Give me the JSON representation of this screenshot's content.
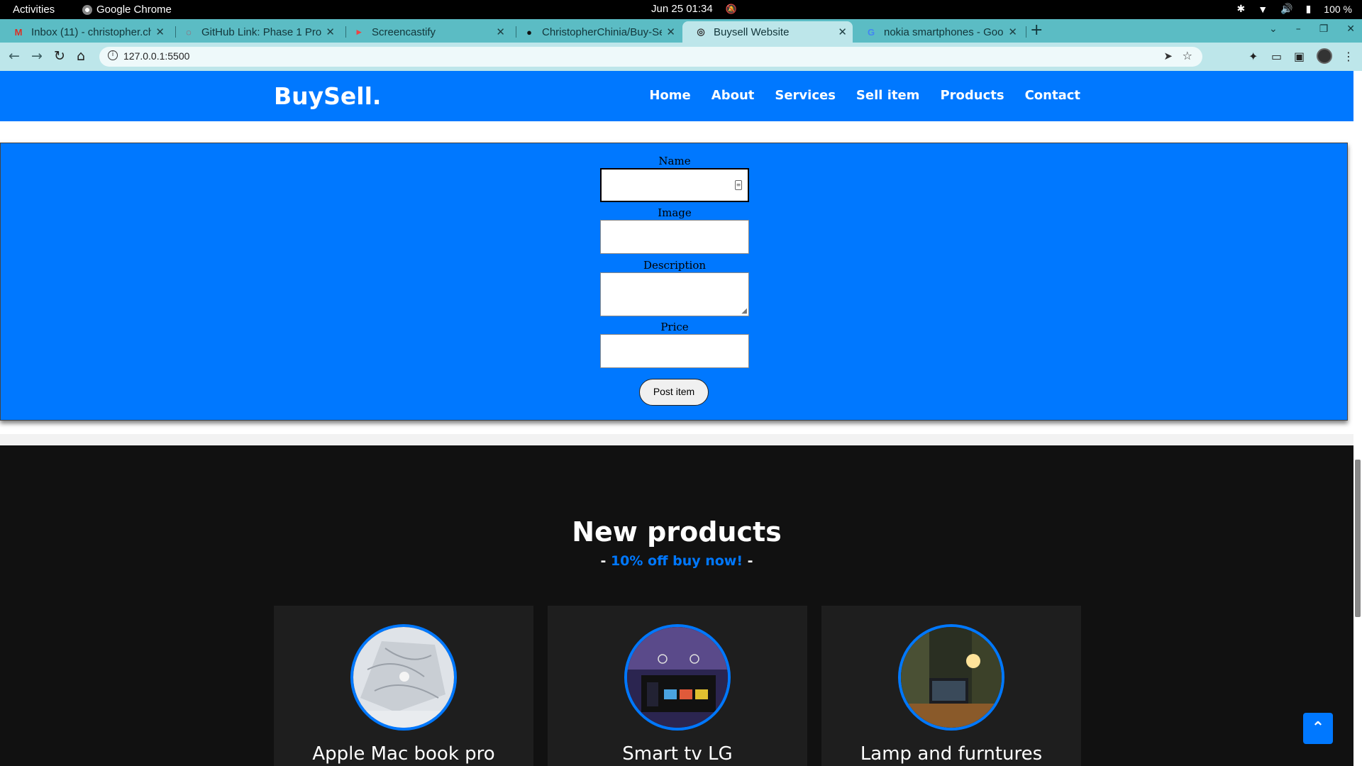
{
  "system_bar": {
    "activities": "Activities",
    "app_name": "Google Chrome",
    "clock": "Jun 25  01:34",
    "battery": "100 %"
  },
  "tabs": [
    {
      "title": "Inbox (11) - christopher.ch",
      "favicon": "gmail-icon",
      "active": false
    },
    {
      "title": "GitHub Link: Phase 1 Proj",
      "favicon": "loading-icon",
      "active": false
    },
    {
      "title": "Screencastify",
      "favicon": "screencastify-icon",
      "active": false
    },
    {
      "title": "ChristopherChinia/Buy-Se",
      "favicon": "github-icon",
      "active": false
    },
    {
      "title": "Buysell Website",
      "favicon": "globe-icon",
      "active": true
    },
    {
      "title": "nokia smartphones - Goo",
      "favicon": "google-icon",
      "active": false
    }
  ],
  "address_bar": {
    "url": "127.0.0.1:5500"
  },
  "site": {
    "brand": "BuySell.",
    "menu": [
      "Home",
      "About",
      "Services",
      "Sell item",
      "Products",
      "Contact"
    ],
    "form": {
      "name_label": "Name",
      "image_label": "Image",
      "description_label": "Description",
      "price_label": "Price",
      "submit_label": "Post item",
      "name_value": "",
      "image_value": "",
      "description_value": "",
      "price_value": ""
    },
    "products": {
      "title": "New products",
      "subtitle_prefix": "- ",
      "subtitle_highlight": "10% off buy now!",
      "subtitle_suffix": " -",
      "items": [
        {
          "name": "Apple Mac book pro"
        },
        {
          "name": "Smart tv LG"
        },
        {
          "name": "Lamp and furntures"
        }
      ]
    }
  },
  "colors": {
    "brand_blue": "#0078ff",
    "tab_strip": "#5bbcc4",
    "dark_bg": "#111111"
  }
}
